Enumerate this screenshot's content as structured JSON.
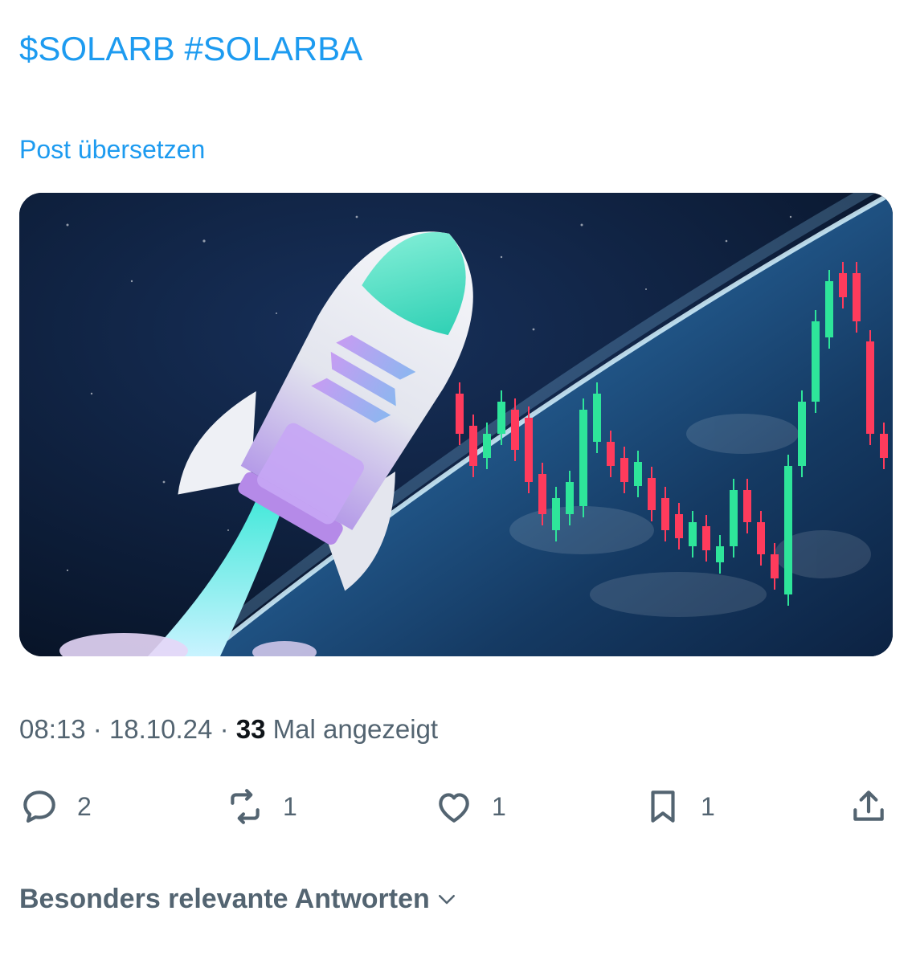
{
  "post": {
    "cashtag": "$SOLARB",
    "hashtag": "#SOLARBA",
    "translate_label": "Post übersetzen",
    "media": {
      "description_icon": "rocket-earth-candlestick-image"
    }
  },
  "meta": {
    "time": "08:13",
    "separator": "·",
    "date": "18.10.24",
    "views_count": "33",
    "views_label": "Mal angezeigt"
  },
  "actions": {
    "reply": {
      "icon": "reply-icon",
      "count": "2"
    },
    "repost": {
      "icon": "repost-icon",
      "count": "1"
    },
    "like": {
      "icon": "heart-icon",
      "count": "1"
    },
    "bookmark": {
      "icon": "bookmark-icon",
      "count": "1"
    },
    "share": {
      "icon": "share-icon"
    }
  },
  "replies": {
    "sort_label": "Besonders relevante Antworten"
  },
  "colors": {
    "link": "#1d9bf0",
    "secondary_text": "#536471",
    "primary_text": "#0f1419",
    "candle_up": "#2ee59a",
    "candle_down": "#ff3b5c"
  }
}
